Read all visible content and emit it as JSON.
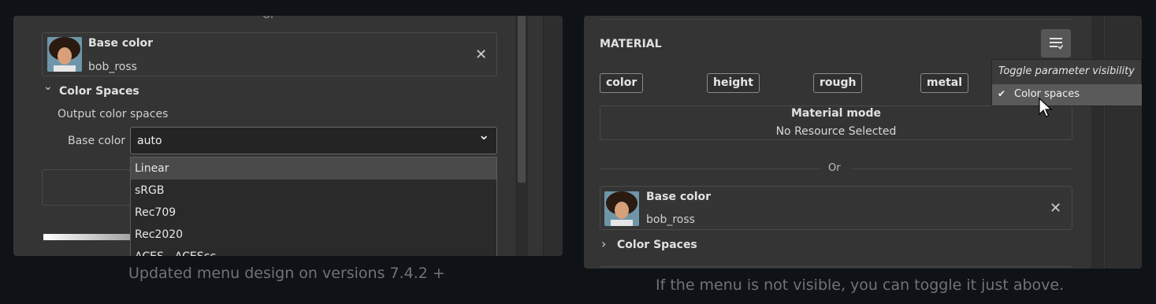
{
  "left": {
    "or_text": "Or",
    "base_color_card": {
      "title": "Base color",
      "subtitle": "bob_ross",
      "close": "✕"
    },
    "color_spaces": {
      "chevron": "⌄",
      "title": "Color Spaces",
      "output_label": "Output color spaces",
      "field_label": "Base color",
      "select_value": "auto",
      "select_chevron": "⌄",
      "options": [
        "Linear",
        "sRGB",
        "Rec709",
        "Rec2020",
        "ACES - ACEScc"
      ],
      "selected_index": 0
    },
    "caption": "Updated menu design on versions 7.4.2 +"
  },
  "right": {
    "section_title": "MATERIAL",
    "chips": [
      "color",
      "height",
      "rough",
      "metal"
    ],
    "popup": {
      "title": "Toggle parameter visibility",
      "item_check": "✔",
      "item_label": "Color spaces"
    },
    "material_mode": {
      "title": "Material mode",
      "value": "No Resource Selected"
    },
    "or_text": "Or",
    "base_color_card": {
      "title": "Base color",
      "subtitle": "bob_ross",
      "close": "✕"
    },
    "color_spaces": {
      "chevron": "›",
      "title": "Color Spaces"
    },
    "caption": "If the menu is not visible, you can toggle it just above."
  },
  "colors": {
    "page_bg": "#0f1216",
    "panel_bg": "#343434",
    "caption": "#6f737a"
  }
}
